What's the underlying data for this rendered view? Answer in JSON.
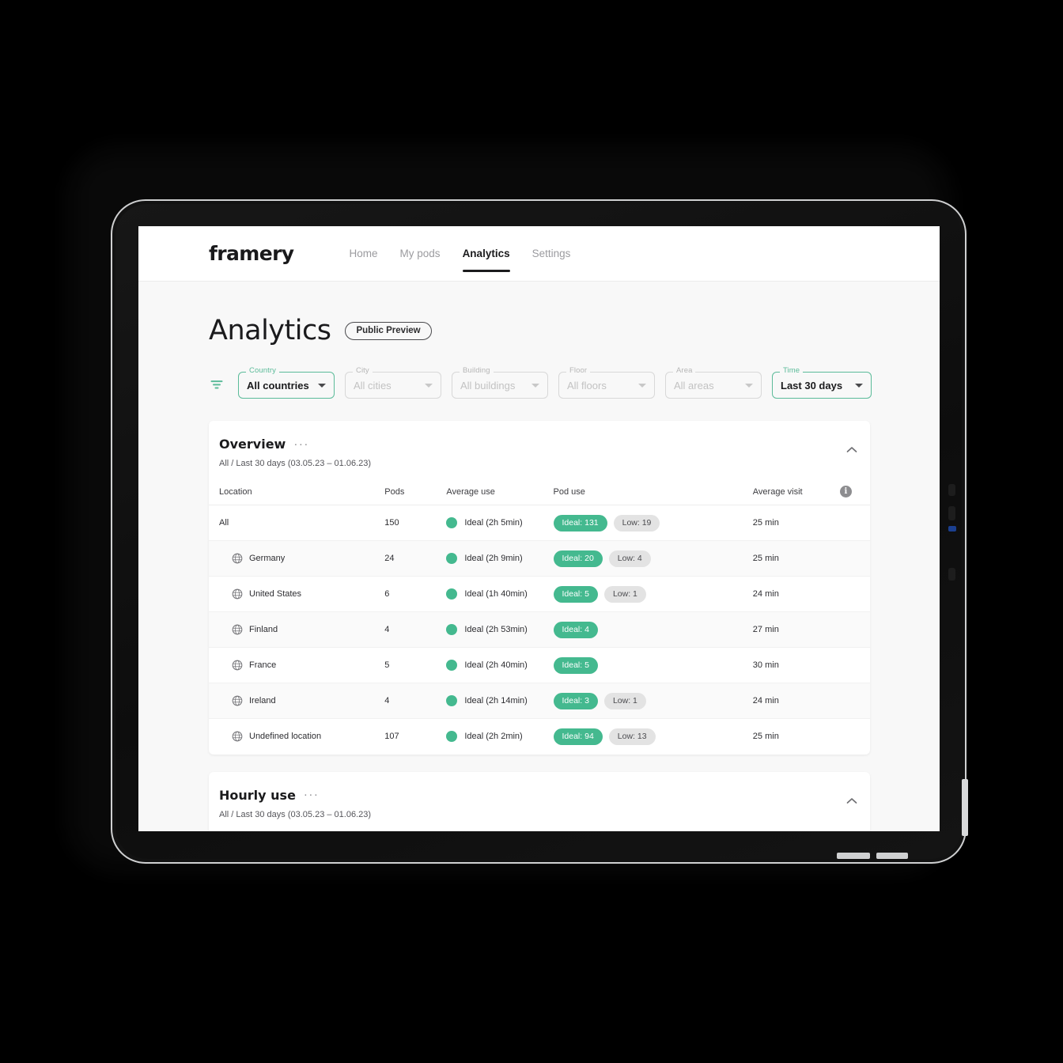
{
  "app": {
    "brand": "framery",
    "nav": [
      {
        "label": "Home",
        "active": false
      },
      {
        "label": "My pods",
        "active": false
      },
      {
        "label": "Analytics",
        "active": true
      },
      {
        "label": "Settings",
        "active": false
      }
    ]
  },
  "page": {
    "title": "Analytics",
    "badge": "Public Preview"
  },
  "filters": {
    "icon": "filter-funnel-icon",
    "fields": [
      {
        "legend": "Country",
        "value": "All countries",
        "active": true
      },
      {
        "legend": "City",
        "value": "All cities",
        "active": false
      },
      {
        "legend": "Building",
        "value": "All buildings",
        "active": false
      },
      {
        "legend": "Floor",
        "value": "All floors",
        "active": false
      },
      {
        "legend": "Area",
        "value": "All areas",
        "active": false
      },
      {
        "legend": "Time",
        "value": "Last 30 days",
        "active": true
      }
    ]
  },
  "overview": {
    "title": "Overview",
    "menu": "···",
    "subtitle": "All / Last 30 days (03.05.23 – 01.06.23)",
    "collapse_icon": "chevron-up-icon",
    "columns": [
      "Location",
      "Pods",
      "Average use",
      "Pod use",
      "Average visit"
    ],
    "info_icon": "info-icon",
    "rows": [
      {
        "location": "All",
        "has_globe": false,
        "indent": false,
        "pods": "150",
        "average_use": "Ideal (2h 5min)",
        "ideal": "Ideal: 131",
        "low": "Low: 19",
        "average_visit": "25 min"
      },
      {
        "location": "Germany",
        "has_globe": true,
        "indent": true,
        "pods": "24",
        "average_use": "Ideal (2h 9min)",
        "ideal": "Ideal: 20",
        "low": "Low: 4",
        "average_visit": "25 min"
      },
      {
        "location": "United States",
        "has_globe": true,
        "indent": true,
        "pods": "6",
        "average_use": "Ideal (1h 40min)",
        "ideal": "Ideal: 5",
        "low": "Low: 1",
        "average_visit": "24 min"
      },
      {
        "location": "Finland",
        "has_globe": true,
        "indent": true,
        "pods": "4",
        "average_use": "Ideal (2h 53min)",
        "ideal": "Ideal: 4",
        "low": "",
        "average_visit": "27 min"
      },
      {
        "location": "France",
        "has_globe": true,
        "indent": true,
        "pods": "5",
        "average_use": "Ideal (2h 40min)",
        "ideal": "Ideal: 5",
        "low": "",
        "average_visit": "30 min"
      },
      {
        "location": "Ireland",
        "has_globe": true,
        "indent": true,
        "pods": "4",
        "average_use": "Ideal (2h 14min)",
        "ideal": "Ideal: 3",
        "low": "Low: 1",
        "average_visit": "24 min"
      },
      {
        "location": "Undefined location",
        "has_globe": true,
        "indent": true,
        "pods": "107",
        "average_use": "Ideal (2h 2min)",
        "ideal": "Ideal: 94",
        "low": "Low: 13",
        "average_visit": "25 min"
      }
    ]
  },
  "hourly": {
    "title": "Hourly use",
    "menu": "···",
    "subtitle": "All / Last 30 days (03.05.23 – 01.06.23)",
    "collapse_icon": "chevron-up-icon"
  },
  "colors": {
    "accent_green": "#44b98f",
    "field_active": "#5bbb99",
    "pill_low_bg": "#e3e3e3",
    "page_bg": "#f8f8f8",
    "text_dark": "#1b1b1d"
  }
}
